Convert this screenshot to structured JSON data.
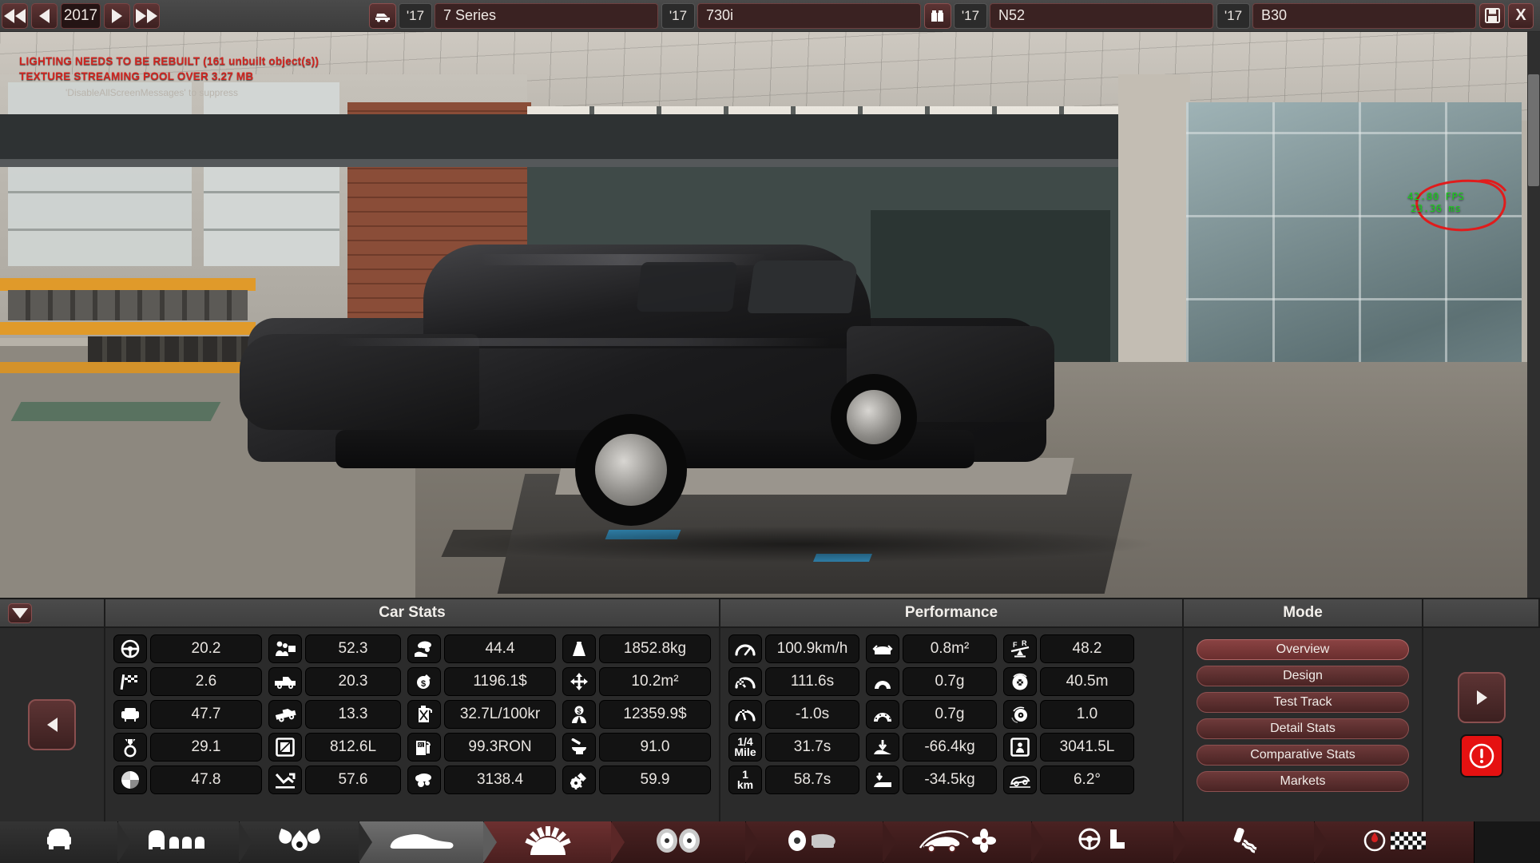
{
  "topbar": {
    "nav": {
      "first_label": "rewind-all",
      "prev_label": "rewind",
      "year": "2017",
      "next_label": "forward",
      "last_label": "forward-all"
    },
    "fields": [
      {
        "icon": "car-icon",
        "year": "'17",
        "value": "7 Series"
      },
      {
        "icon": "",
        "year": "'17",
        "value": "730i"
      },
      {
        "icon": "engine-icon",
        "year": "'17",
        "value": "N52"
      },
      {
        "icon": "",
        "year": "'17",
        "value": "B30"
      }
    ],
    "save_label": "■",
    "close_label": "X"
  },
  "viewport": {
    "warnings": [
      "LIGHTING NEEDS TO BE REBUILT (161 unbuilt object(s))",
      "TEXTURE STREAMING POOL OVER 3.27 MB"
    ],
    "warning_suppress": "'DisableAllScreenMessages' to suppress",
    "fps": "42.80 FPS",
    "frametime": "23.36 ms"
  },
  "hud": {
    "headers": {
      "car_stats": "Car Stats",
      "performance": "Performance",
      "mode": "Mode"
    },
    "car_stats": [
      [
        {
          "icon": "steering-wheel-icon",
          "value": "20.2"
        },
        {
          "icon": "checkered-flag-icon",
          "value": "2.6"
        },
        {
          "icon": "armchair-icon",
          "value": "47.7"
        },
        {
          "icon": "diamond-ring-icon",
          "value": "29.1"
        },
        {
          "icon": "pie-chart-icon",
          "value": "47.8"
        }
      ],
      [
        {
          "icon": "family-tv-icon",
          "value": "52.3"
        },
        {
          "icon": "pickup-truck-icon",
          "value": "20.3"
        },
        {
          "icon": "offroad-car-icon",
          "value": "13.3"
        },
        {
          "icon": "cargo-box-icon",
          "value": "812.6L"
        },
        {
          "icon": "depreciation-arrow-icon",
          "value": "57.6"
        }
      ],
      [
        {
          "icon": "emissions-hand-icon",
          "value": "44.4"
        },
        {
          "icon": "service-cost-icon",
          "value": "1196.1$"
        },
        {
          "icon": "jerrycan-icon",
          "value": "32.7L/100kr"
        },
        {
          "icon": "fuel-pump-icon",
          "value": "99.3RON"
        },
        {
          "icon": "emissions-cloud-icon",
          "value": "3138.4"
        }
      ],
      [
        {
          "icon": "weight-icon",
          "value": "1852.8kg"
        },
        {
          "icon": "footprint-arrows-icon",
          "value": "10.2m²"
        },
        {
          "icon": "production-cost-icon",
          "value": "12359.9$"
        },
        {
          "icon": "anvil-hammer-icon",
          "value": "91.0"
        },
        {
          "icon": "gear-wrench-icon",
          "value": "59.9"
        }
      ]
    ],
    "performance": [
      [
        {
          "icon": "speedometer-icon",
          "value": "100.9km/h"
        },
        {
          "icon": "lap-time-icon",
          "value": "111.6s"
        },
        {
          "icon": "accel-gauge-icon",
          "value": "-1.0s"
        },
        {
          "icon": "quarter-mile-text",
          "icon_text": "1/4\nMile",
          "value": "31.7s"
        },
        {
          "icon": "one-km-text",
          "icon_text": "1\nkm",
          "value": "58.7s"
        }
      ],
      [
        {
          "icon": "frontal-area-icon",
          "value": "0.8m²"
        },
        {
          "icon": "corner-grip-icon",
          "value": "0.7g"
        },
        {
          "icon": "corner-grip-dashed-icon",
          "value": "0.7g"
        },
        {
          "icon": "downforce-front-icon",
          "value": "-66.4kg"
        },
        {
          "icon": "downforce-rear-icon",
          "value": "-34.5kg"
        }
      ],
      [
        {
          "icon": "weight-balance-icon",
          "icon_text": "F  R",
          "value": "48.2"
        },
        {
          "icon": "brake-disc-icon",
          "value": "40.5m"
        },
        {
          "icon": "brake-fade-icon",
          "value": "1.0"
        },
        {
          "icon": "passenger-space-icon",
          "value": "3041.5L"
        },
        {
          "icon": "car-tilt-icon",
          "value": "6.2°"
        }
      ]
    ],
    "mode_buttons": [
      {
        "label": "Overview",
        "active": true
      },
      {
        "label": "Design",
        "active": false
      },
      {
        "label": "Test Track",
        "active": false
      },
      {
        "label": "Detail Stats",
        "active": false
      },
      {
        "label": "Comparative Stats",
        "active": false
      },
      {
        "label": "Markets",
        "active": false
      }
    ],
    "left_nav_label": "previous-section",
    "right_nav_label": "next-section",
    "alert_label": "!",
    "collapse_label": "collapse-panel"
  },
  "tabs": [
    {
      "icon": "car-front-icon",
      "state": "dark"
    },
    {
      "icon": "car-lineup-icon",
      "state": "dark"
    },
    {
      "icon": "fuel-drops-icon",
      "state": "dark"
    },
    {
      "icon": "car-body-icon",
      "state": "sel"
    },
    {
      "icon": "engine-block-icon",
      "state": "redsel"
    },
    {
      "icon": "wheels-icon",
      "state": "red"
    },
    {
      "icon": "brakes-icon",
      "state": "red"
    },
    {
      "icon": "aero-fan-icon",
      "state": "red"
    },
    {
      "icon": "interior-seat-icon",
      "state": "red"
    },
    {
      "icon": "suspension-icon",
      "state": "red"
    },
    {
      "icon": "testing-flag-icon",
      "state": "red"
    }
  ],
  "colors": {
    "accent_red": "#8a4343",
    "panel_bg": "#2b2b2b",
    "tile_bg": "#131313",
    "warning_red": "#d1241f",
    "fps_green": "#18d418"
  }
}
